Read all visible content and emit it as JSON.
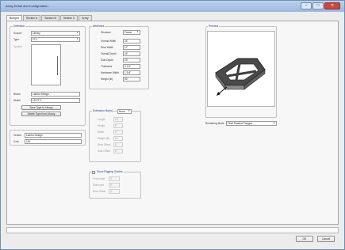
{
  "window": {
    "title": "Array Detail and Configuration",
    "minimize_glyph": "–",
    "maximize_glyph": "□",
    "close_glyph": "✕"
  },
  "tabs": [
    "Bumper",
    "Section A",
    "Section B",
    "Section C",
    "Array"
  ],
  "definition": {
    "legend": "Definition",
    "source_label": "Source:",
    "source_value": "Library",
    "type_label": "Type:",
    "type_value": "FF 1",
    "symbol_label": "Symbol",
    "brand_label": "Brand",
    "brand_value": "Lambo Design",
    "model_label": "Model",
    "model_value": "LD-FF 1",
    "save_button": "Save Type to Library",
    "delete_button": "Delete Type from Library",
    "vendor_label": "Vendor",
    "vendor_value": "Lambo Design",
    "cost_label": "Cost",
    "cost_value": "100"
  },
  "attributes": {
    "legend": "Attributes",
    "structure_label": "Structure",
    "structure_value": "Frame",
    "rows": [
      {
        "label": "Overall Width",
        "value": "24'"
      },
      {
        "label": "Rear Width",
        "value": "17'"
      },
      {
        "label": "Overall Depth",
        "value": "24'"
      },
      {
        "label": "Side Depth",
        "value": "23'"
      },
      {
        "label": "Thickness",
        "value": "4 1/2\""
      },
      {
        "label": "Hardware Width",
        "value": "1 3/4\""
      },
      {
        "label": "Weight (lb)",
        "value": "50"
      }
    ]
  },
  "extension": {
    "legend": "Extension Bar(s)",
    "mode_value": "None",
    "rows": [
      {
        "label": "Length",
        "value": "10'"
      },
      {
        "label": "Height",
        "value": "0'"
      },
      {
        "label": "Width",
        "value": "0'"
      },
      {
        "label": "Weight (lb)",
        "value": "10"
      },
      {
        "label": "Rear Offset",
        "value": "0'"
      },
      {
        "label": "Side Offset",
        "value": "0'"
      }
    ]
  },
  "rigging": {
    "legend": "Show Rigging Guides",
    "checked": false,
    "rows": [
      {
        "label": "Front Inset",
        "value": "0'"
      },
      {
        "label": "Side Inset",
        "value": "0'"
      },
      {
        "label": "Rear Offset",
        "value": "0'"
      }
    ]
  },
  "preview": {
    "legend": "Preview",
    "rendering_label": "Rendering Mode",
    "rendering_value": "Final Shaded Polygon"
  },
  "footer": {
    "ok": "OK",
    "cancel": "Cancel"
  }
}
